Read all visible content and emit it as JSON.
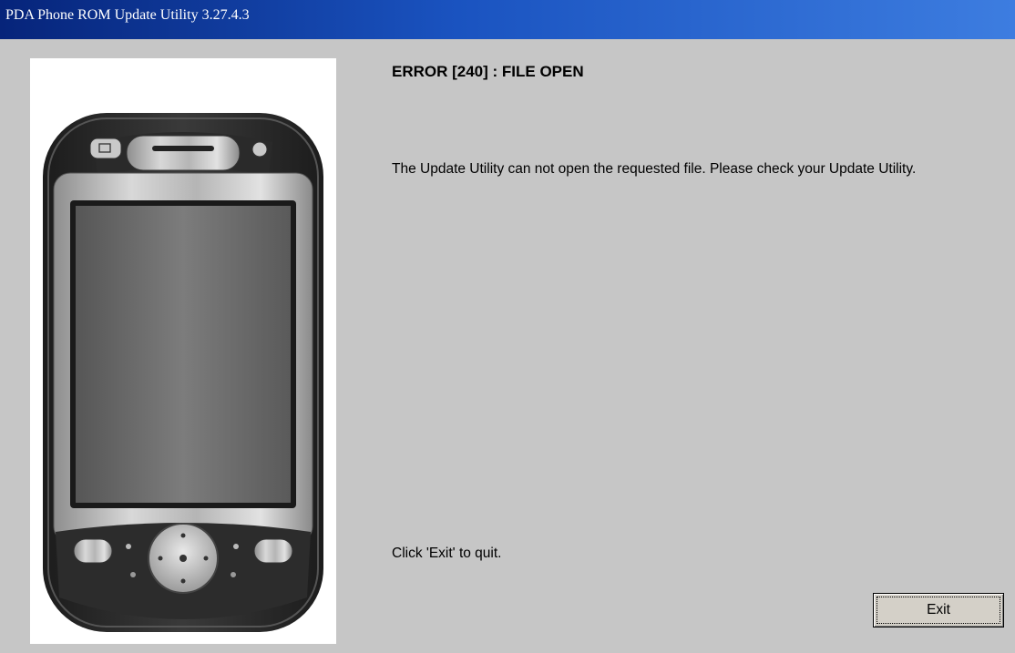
{
  "window": {
    "title": "PDA Phone ROM Update Utility 3.27.4.3"
  },
  "image": {
    "icon": "pda-phone-image"
  },
  "error": {
    "title": "ERROR [240] : FILE OPEN",
    "message": "The Update Utility can not open the requested file. Please check your Update Utility."
  },
  "footer": {
    "hint": "Click 'Exit' to quit.",
    "exit_label": "Exit"
  },
  "colors": {
    "titlebar_start": "#06247a",
    "titlebar_end": "#3d7de0",
    "window_background": "#c6c6c6"
  }
}
